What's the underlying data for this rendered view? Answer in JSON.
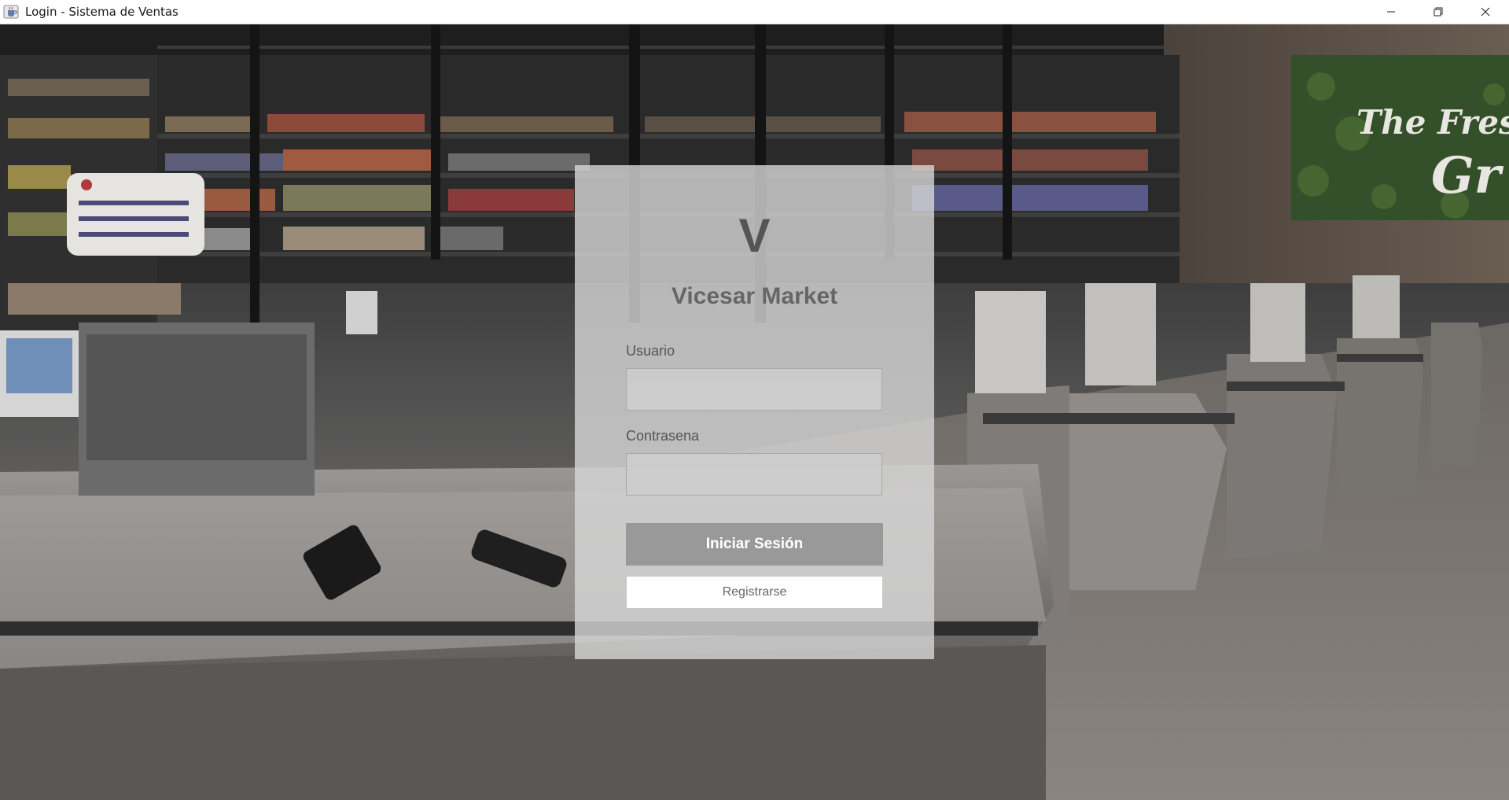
{
  "window": {
    "title": "Login - Sistema de Ventas",
    "icon": "java-cup-icon",
    "controls": [
      "minimize-icon",
      "restore-icon",
      "close-icon"
    ]
  },
  "background": {
    "sign_text_line1": "The Fres",
    "sign_text_line2": "Gr"
  },
  "login": {
    "logo_letter": "V",
    "brand_name": "Vicesar Market",
    "username_label": "Usuario",
    "username_value": "",
    "password_label": "Contrasena",
    "password_value": "",
    "login_button": "Iniciar Sesión",
    "register_button": "Registrarse"
  },
  "colors": {
    "card_bg": "#d7d7d7",
    "login_button_bg": "#999999",
    "register_button_bg": "#ffffff",
    "sign_green": "#3d5a2a"
  }
}
